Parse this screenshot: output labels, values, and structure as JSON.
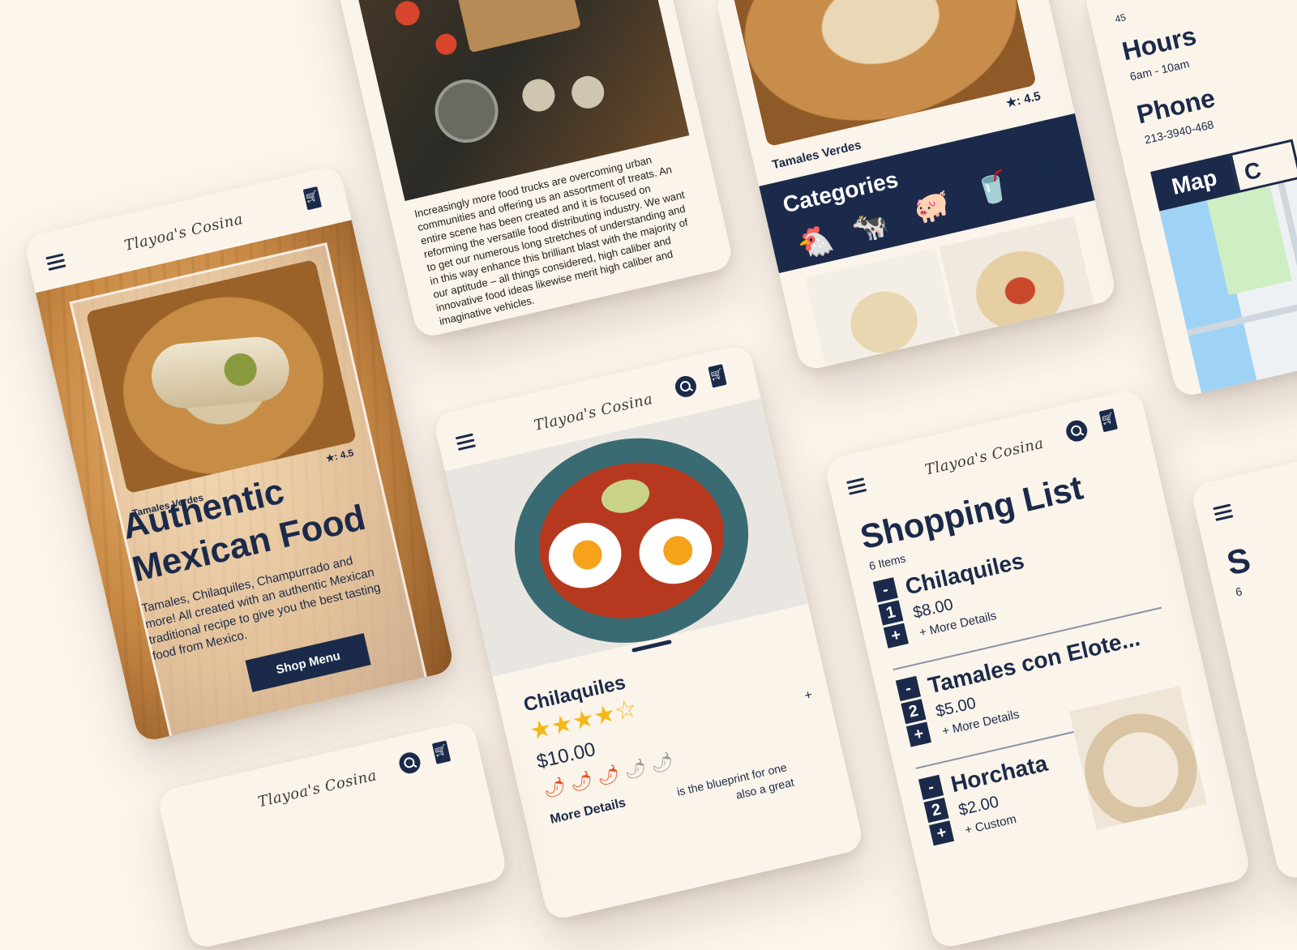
{
  "brand": {
    "logo_text": "Tlayoa's Cosina"
  },
  "hero": {
    "rating": "★: 4.5",
    "dish_caption": "Tamales Verdes",
    "title_line1": "Authentic",
    "title_line2": "Mexican Food",
    "description": "Tamales, Chilaquiles, Champurrado and more! All created with an authentic Mexican traditional recipe to give you the best tasting food from Mexico.",
    "cta_label": "Shop Menu"
  },
  "article": {
    "body": "Increasingly more food trucks are overcoming urban communities and offering us an assortment of treats. An entire scene has been created and it is focused on reforming the versatile food distributing industry. We want to get our numerous long stretches of understanding and in this way enhance this brilliant blast with the majority of our aptitude – all things considered, high caliber and innovative food ideas likewise merit high caliber and imaginative vehicles."
  },
  "categories_screen": {
    "rating": "★: 4.5",
    "dish_caption": "Tamales Verdes",
    "heading": "Categories",
    "icons": [
      "🐔",
      "🐄",
      "🐖",
      "🥤",
      "☕"
    ]
  },
  "info_screen": {
    "hours_label": "Hours",
    "hours_value": "6am - 10am",
    "phone_label": "Phone",
    "phone_value": "213-3940-468",
    "tab_map": "Map",
    "tab_other": "C",
    "top_fragment": "45"
  },
  "product": {
    "name": "Chilaquiles",
    "price": "$10.00",
    "rating_stars": 4.5,
    "spice_icons": [
      "🌶",
      "🌶",
      "🌶",
      "🌶",
      "🌶"
    ],
    "more_details": "More Details",
    "plus": "+",
    "description_fragment": "is the blueprint for one",
    "description_fragment2": "also a great"
  },
  "shopping_list": {
    "title": "Shopping List",
    "count": "6 Items",
    "items": [
      {
        "name": "Chilaquiles",
        "qty": "1",
        "price": "$8.00",
        "details": "+ More Details"
      },
      {
        "name": "Tamales con Elote...",
        "qty": "2",
        "price": "$5.00",
        "details": "+ More Details"
      },
      {
        "name": "Horchata",
        "qty": "2",
        "price": "$2.00",
        "details": "+ Custom"
      }
    ],
    "minus": "-",
    "plus": "+"
  },
  "edge_screen": {
    "title_fragment": "S",
    "count_fragment": "6"
  }
}
